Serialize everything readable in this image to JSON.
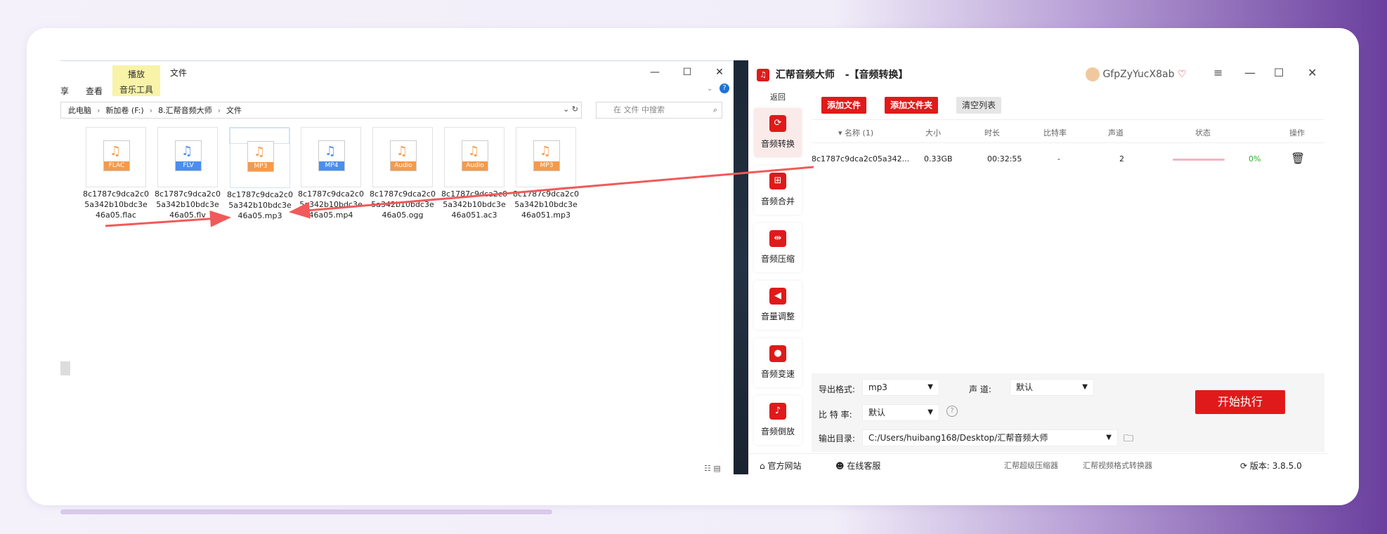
{
  "explorer": {
    "ribbon_tabs": [
      "享",
      "查看",
      "播放",
      "音乐工具",
      "文件"
    ],
    "window_buttons": [
      "—",
      "☐",
      "✕"
    ],
    "breadcrumb": [
      "此电脑",
      "新加卷 (F:)",
      "8.汇帮音频大师",
      "文件"
    ],
    "search_placeholder": "在 文件 中搜索",
    "files": [
      {
        "band": "FLAC",
        "color": "#f59a4a",
        "name": "8c1787c9dca2c05a342b10bdc3e46a05.flac"
      },
      {
        "band": "FLV",
        "color": "#4a8ef0",
        "name": "8c1787c9dca2c05a342b10bdc3e46a05.flv"
      },
      {
        "band": "MP3",
        "color": "#f59a4a",
        "name": "8c1787c9dca2c05a342b10bdc3e46a05.mp3"
      },
      {
        "band": "MP4",
        "color": "#4a8ef0",
        "name": "8c1787c9dca2c05a342b10bdc3e46a05.mp4"
      },
      {
        "band": "Audio",
        "color": "#f59a4a",
        "name": "8c1787c9dca2c05a342b10bdc3e46a05.ogg"
      },
      {
        "band": "Audio",
        "color": "#f59a4a",
        "name": "8c1787c9dca2c05a342b10bdc3e46a051.ac3"
      },
      {
        "band": "MP3",
        "color": "#f59a4a",
        "name": "8c1787c9dca2c05a342b10bdc3e46a051.mp3"
      }
    ]
  },
  "app": {
    "title": "汇帮音频大师",
    "subtitle": "-【音频转换】",
    "user": "GfpZyYucX8ab",
    "back": "返回",
    "nav": [
      "音频转换",
      "音频合并",
      "音频压缩",
      "音量调整",
      "音频变速",
      "音频倒放"
    ],
    "toolbar": {
      "add_file": "添加文件",
      "add_folder": "添加文件夹",
      "clear": "清空列表"
    },
    "columns": [
      "名称 (1)",
      "大小",
      "时长",
      "比特率",
      "声道",
      "状态",
      "操作"
    ],
    "row": {
      "name": "8c1787c9dca2c05a342...",
      "size": "0.33GB",
      "duration": "00:32:55",
      "bitrate": "-",
      "channels": "2",
      "progress": "0%"
    },
    "progress_value": 0,
    "settings": {
      "format_label": "导出格式:",
      "format_value": "mp3",
      "channel_label": "声 道:",
      "channel_value": "默认",
      "bitrate_label": "比 特 率:",
      "bitrate_value": "默认",
      "outdir_label": "输出目录:",
      "outdir_value": "C:/Users/huibang168/Desktop/汇帮音频大师"
    },
    "start": "开始执行",
    "footer": {
      "site": "官方网站",
      "service": "在线客服",
      "link1": "汇帮超级压缩器",
      "link2": "汇帮视频格式转换器",
      "version": "版本: 3.8.5.0"
    },
    "accent": "#e01a1a"
  }
}
